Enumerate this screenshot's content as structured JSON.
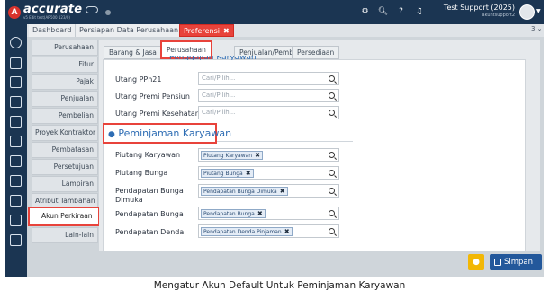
{
  "app": {
    "brand": "accurate",
    "brand_sub": "v5 Edit test(AR500 123/0)",
    "user_name": "Test Support (2025)",
    "user_sub": "akuntsupport2"
  },
  "tabs": [
    {
      "label": "Dashboard"
    },
    {
      "label": "Persiapan Data Perusahaan"
    },
    {
      "label": "Preferensi",
      "close": "✖"
    }
  ],
  "tab_more": "3 ⌄",
  "left_nav": [
    {
      "label": "Perusahaan"
    },
    {
      "label": "Fitur"
    },
    {
      "label": "Pajak"
    },
    {
      "label": "Penjualan"
    },
    {
      "label": "Pembelian"
    },
    {
      "label": "Proyek Kontraktor"
    },
    {
      "label": "Pembatasan"
    },
    {
      "label": "Persetujuan"
    },
    {
      "label": "Lampiran"
    },
    {
      "label": "Atribut Tambahan"
    },
    {
      "label": "Akun Perkiraan"
    },
    {
      "label": "Lain-lain"
    }
  ],
  "panel_tabs": [
    {
      "label": "Barang & Jasa"
    },
    {
      "label": "Perusahaan"
    },
    {
      "label": "Penjualan/Pembelian"
    },
    {
      "label": "Persediaan"
    }
  ],
  "cut_section_title": "Penggajian Karyawan",
  "upper_rows": [
    {
      "label": "Utang PPh21",
      "placeholder": "Cari/Pilih..."
    },
    {
      "label": "Utang Premi Pensiun",
      "placeholder": "Cari/Pilih..."
    },
    {
      "label": "Utang Premi Kesehatan",
      "placeholder": "Cari/Pilih..."
    }
  ],
  "section_title": "Peminjaman Karyawan",
  "lower_rows": [
    {
      "label": "Piutang Karyawan",
      "chip": "Piutang Karyawan"
    },
    {
      "label": "Piutang Bunga",
      "chip": "Piutang Bunga"
    },
    {
      "label": "Pendapatan Bunga",
      "label2": "Dimuka",
      "chip": "Pendapatan Bunga Dimuka"
    },
    {
      "label": "Pendapatan Bunga",
      "chip": "Pendapatan Bunga"
    },
    {
      "label": "Pendapatan Denda",
      "chip": "Pendapatan Denda Pinjaman"
    }
  ],
  "chip_remove": "✖",
  "save_label": "Simpan",
  "caption": "Mengatur Akun Default Untuk Peminjaman Karyawan",
  "colors": {
    "nav_dark": "#1b3552",
    "highlight_red": "#e8433b",
    "save_blue": "#23589b",
    "accent_yellow": "#f2b705"
  }
}
